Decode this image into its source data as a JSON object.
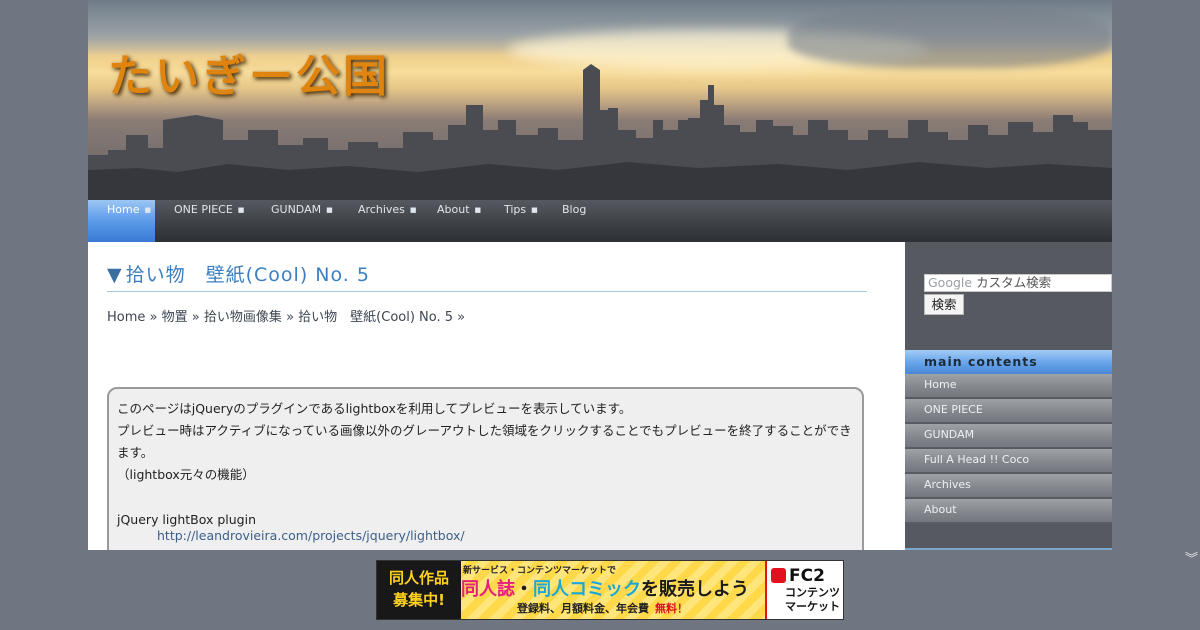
{
  "site": {
    "title": "たいぎー公国"
  },
  "nav": {
    "items": [
      {
        "label": "Home",
        "active": true,
        "has_submenu": true
      },
      {
        "label": "ONE PIECE",
        "has_submenu": true
      },
      {
        "label": "GUNDAM",
        "has_submenu": true
      },
      {
        "label": "Archives",
        "has_submenu": true
      },
      {
        "label": "About",
        "has_submenu": true
      },
      {
        "label": "Tips",
        "has_submenu": true
      },
      {
        "label": "Blog",
        "has_submenu": false
      }
    ]
  },
  "page": {
    "title_arrow": "▼",
    "title": "拾い物　壁紙(Cool) No. 5",
    "breadcrumb": [
      "Home",
      "物置",
      "拾い物画像集",
      "拾い物　壁紙(Cool) No. 5"
    ],
    "breadcrumb_sep": "»",
    "notice": {
      "line1": "このページはjQueryのプラグインであるlightboxを利用してプレビューを表示しています。",
      "line2": "プレビュー時はアクティブになっている画像以外のグレーアウトした領域をクリックすることでもプレビューを終了することができます。",
      "line3": "（lightbox元々の機能）",
      "plugin_name": "jQuery lightBox plugin",
      "plugin_url": "http://leandrovieira.com/projects/jquery/lightbox/"
    }
  },
  "sidebar": {
    "search": {
      "logo": "Google",
      "placeholder": "カスタム検索",
      "button": "検索"
    },
    "heading": "main contents",
    "items": [
      "Home",
      "ONE PIECE",
      "GUNDAM",
      "Full A Head !! Coco",
      "Archives",
      "About"
    ]
  },
  "ad": {
    "left_line1": "同人作品",
    "left_line2": "募集中!",
    "tag": "新サービス・コンテンツマーケットで",
    "main_pink": "同人誌",
    "main_dot": "・",
    "main_cyan": "同人コミック",
    "main_rest": "を販売しよう",
    "bottom": "登録料、月額料金、年会費",
    "bottom_red": "無料！",
    "brand": "FC2",
    "brand_sub1": "コンテンツ",
    "brand_sub2": "マーケット"
  },
  "colors": {
    "accent_blue": "#5b9be9",
    "title_blue": "#3b7fc0",
    "title_orange": "#e08410",
    "background": "#6f7682"
  },
  "icons": {
    "expand": "double-chevron-down-icon",
    "nav_dot": "square-dot-icon"
  }
}
